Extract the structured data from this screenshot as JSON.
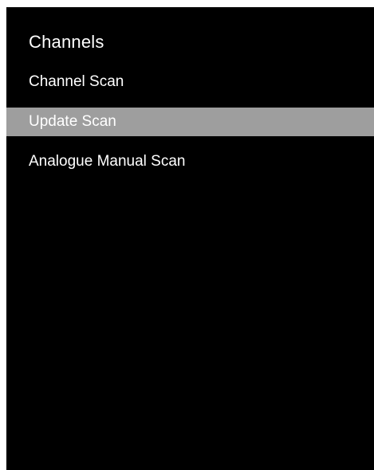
{
  "menu": {
    "title": "Channels",
    "items": [
      {
        "label": "Channel Scan",
        "selected": false
      },
      {
        "label": "Update Scan",
        "selected": true
      },
      {
        "label": "Analogue Manual Scan",
        "selected": false
      }
    ]
  },
  "colors": {
    "background": "#000000",
    "text": "#ffffff",
    "highlight": "#9e9e9e",
    "page": "#ffffff"
  }
}
